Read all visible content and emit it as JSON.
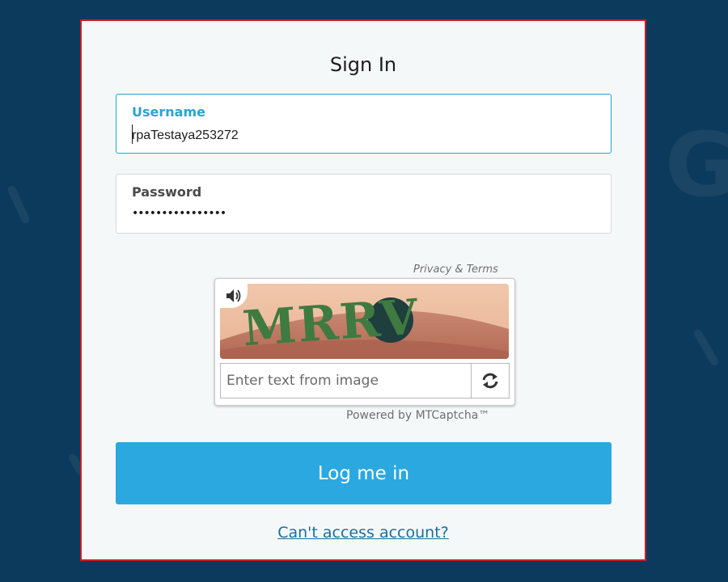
{
  "page": {
    "title": "Sign In"
  },
  "form": {
    "username": {
      "label": "Username",
      "value": "rpaTestaya253272"
    },
    "password": {
      "label": "Password",
      "masked_value": "••••••••••••••••"
    },
    "login_button": "Log me in",
    "access_link": "Can't access account?"
  },
  "captcha": {
    "privacy_terms": "Privacy & Terms",
    "image_text": "MRRV",
    "input_placeholder": "Enter text from image",
    "powered_by": "Powered by MTCaptcha™",
    "audio_icon": "speaker-icon",
    "refresh_icon": "refresh-icon"
  },
  "colors": {
    "background": "#0c3a5c",
    "card_border": "#cf1c24",
    "accent": "#2ba8e0",
    "focus_border": "#2ba3cf",
    "link": "#1a6e9b"
  }
}
